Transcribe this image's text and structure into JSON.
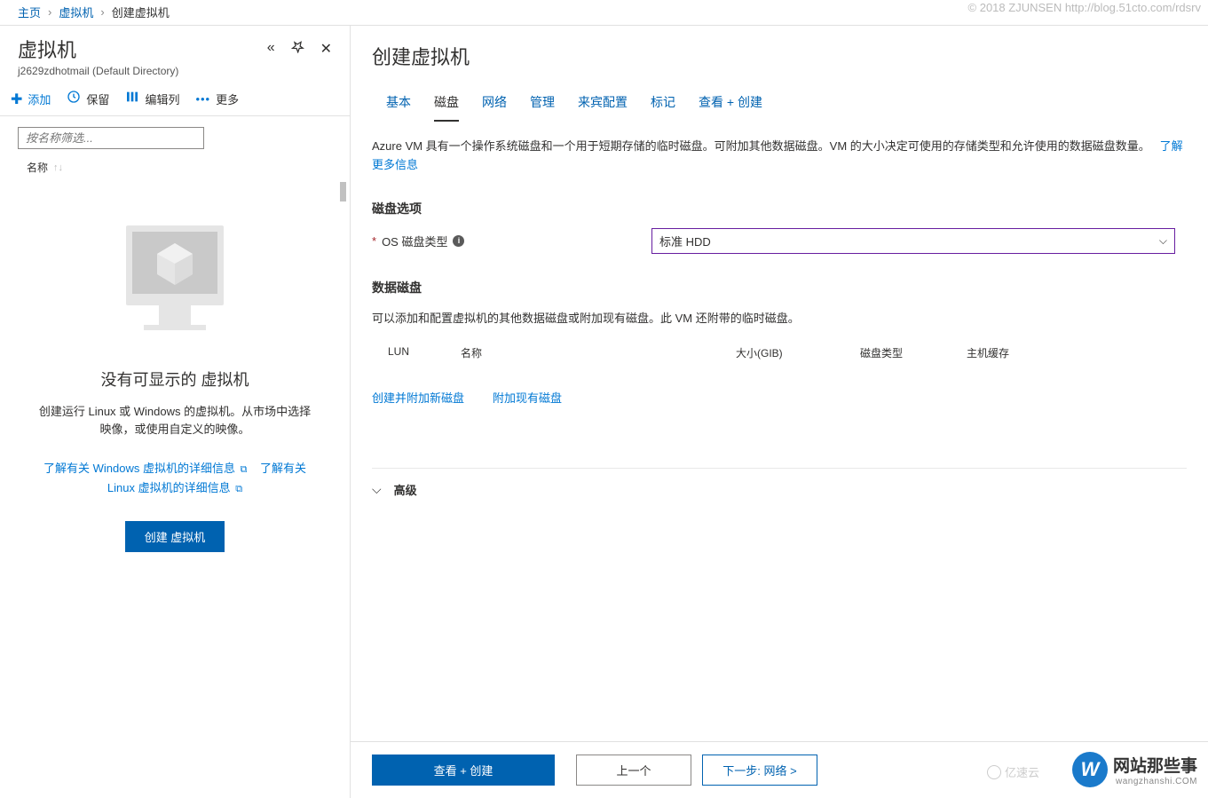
{
  "watermark_top": "© 2018 ZJUNSEN http://blog.51cto.com/rdsrv",
  "breadcrumb": {
    "home": "主页",
    "vm": "虚拟机",
    "create": "创建虚拟机"
  },
  "left": {
    "title": "虚拟机",
    "subtitle": "j2629zdhotmail (Default Directory)",
    "toolbar": {
      "add": "添加",
      "keep": "保留",
      "edit_cols": "编辑列",
      "more": "更多"
    },
    "filter_placeholder": "按名称筛选...",
    "col_name": "名称",
    "empty_title": "没有可显示的 虚拟机",
    "empty_desc": "创建运行 Linux 或 Windows 的虚拟机。从市场中选择映像，或使用自定义的映像。",
    "link_win": "了解有关 Windows 虚拟机的详细信息",
    "link_linux": "了解有关 Linux 虚拟机的详细信息",
    "create_btn": "创建 虚拟机"
  },
  "right": {
    "title": "创建虚拟机",
    "tabs": {
      "basic": "基本",
      "disk": "磁盘",
      "network": "网络",
      "manage": "管理",
      "guest": "来宾配置",
      "tag": "标记",
      "review": "查看 + 创建"
    },
    "desc": "Azure VM 具有一个操作系统磁盘和一个用于短期存储的临时磁盘。可附加其他数据磁盘。VM 的大小决定可使用的存储类型和允许使用的数据磁盘数量。",
    "desc_link": "了解更多信息",
    "section_disk_opt": "磁盘选项",
    "os_disk_label": "OS 磁盘类型",
    "os_disk_value": "标准 HDD",
    "section_data_disk": "数据磁盘",
    "data_disk_desc": "可以添加和配置虚拟机的其他数据磁盘或附加现有磁盘。此 VM 还附带的临时磁盘。",
    "cols": {
      "lun": "LUN",
      "name": "名称",
      "size": "大小(GIB)",
      "type": "磁盘类型",
      "cache": "主机缓存"
    },
    "act_create": "创建并附加新磁盘",
    "act_attach": "附加现有磁盘",
    "advanced": "高级",
    "footer": {
      "review": "查看 + 创建",
      "prev": "上一个",
      "next": "下一步: 网络 >"
    }
  },
  "wm_logo": {
    "text": "网站那些事",
    "sub": "wangzhanshi.COM",
    "yun": "亿速云"
  }
}
